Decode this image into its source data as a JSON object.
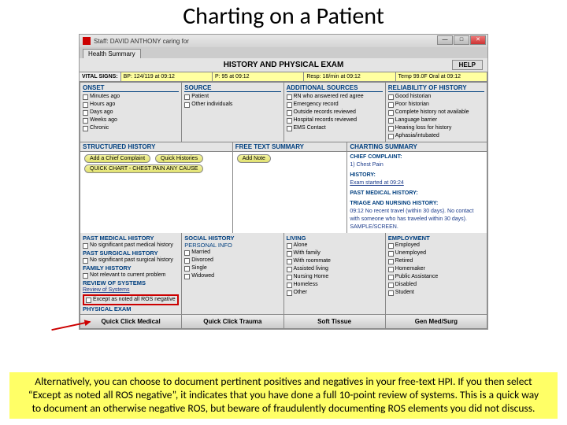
{
  "slide_title": "Charting on a Patient",
  "window": {
    "title": "Staff: DAVID ANTHONY caring for",
    "tab": "Health Summary",
    "main_header": "HISTORY AND PHYSICAL EXAM",
    "help": "HELP"
  },
  "vitals": {
    "label": "VITAL SIGNS:",
    "bp": "BP: 124/119 at 09:12",
    "pulse": "P: 95 at 09:12",
    "resp": "Resp: 18/min at 09:12",
    "temp": "Temp 99.0F Oral at 09:12"
  },
  "onset": {
    "hdr": "ONSET",
    "items": [
      "Minutes ago",
      "Hours ago",
      "Days ago",
      "Weeks ago",
      "Chronic"
    ]
  },
  "source": {
    "hdr": "SOURCE",
    "items": [
      "Patient",
      "Other individuals"
    ]
  },
  "addl": {
    "hdr": "ADDITIONAL SOURCES",
    "items": [
      "RN who answered red agree",
      "Emergency record",
      "Outside records reviewed",
      "Hospital records reviewed",
      "EMS Contact"
    ]
  },
  "reliability": {
    "hdr": "RELIABILITY OF HISTORY",
    "items": [
      "Good historian",
      "Poor historian",
      "Complete history not available",
      "Language barrier",
      "Hearing loss for history",
      "Aphasia/intubated"
    ]
  },
  "structured": {
    "hdr": "STRUCTURED HISTORY",
    "btn1": "Add a Chief Complaint",
    "btn2": "Quick Histories",
    "btn3": "QUICK CHART - CHEST PAIN ANY CAUSE"
  },
  "freetext": {
    "hdr": "FREE TEXT SUMMARY",
    "btn": "Add Note"
  },
  "charting": {
    "hdr": "CHARTING SUMMARY",
    "cc_hdr": "CHIEF COMPLAINT:",
    "cc": "1) Chest Pain",
    "hist_hdr": "HISTORY:",
    "hist": "Exam started at 09:24",
    "pmh_hdr": "PAST MEDICAL HISTORY:",
    "triage_hdr": "TRIAGE AND NURSING HISTORY:",
    "triage": "09:12  No recent travel (within 30 days).  No contact with someone who has traveled within 30 days).  SAMPLE/SCREEN."
  },
  "pmh": {
    "hdr": "PAST MEDICAL HISTORY",
    "item": "No significant past medical history"
  },
  "psh": {
    "hdr": "PAST SURGICAL HISTORY",
    "item": "No significant past surgical history"
  },
  "fh": {
    "hdr": "FAMILY HISTORY",
    "item": "Not relevant to current problem"
  },
  "ros": {
    "hdr": "REVIEW OF SYSTEMS",
    "item1": "Review of Systems",
    "item2": "Except as noted all ROS negative"
  },
  "pe": {
    "hdr": "PHYSICAL EXAM"
  },
  "social": {
    "hdr": "SOCIAL HISTORY",
    "sub": "PERSONAL INFO",
    "items": [
      "Married",
      "Divorced",
      "Single",
      "Widowed"
    ]
  },
  "living": {
    "hdr": "LIVING",
    "items": [
      "Alone",
      "With family",
      "With roommate",
      "Assisted living",
      "Nursing Home",
      "Homeless",
      "Other"
    ]
  },
  "employment": {
    "hdr": "EMPLOYMENT",
    "items": [
      "Employed",
      "Unemployed",
      "Retired",
      "Homemaker",
      "Public Assistance",
      "Disabled",
      "Student"
    ]
  },
  "buttons": {
    "b1": "Quick Click Medical",
    "b2": "Quick Click Trauma",
    "b3": "Soft Tissue",
    "b4": "Gen Med/Surg"
  },
  "caption": "Alternatively, you can choose to document pertinent positives and negatives in your free-text HPI. If you then select “Except as noted all ROS negative”, it indicates that you have done a full 10-point review of systems. This is a quick way to document an otherwise negative ROS, but beware of fraudulently documenting ROS elements you did not discuss."
}
